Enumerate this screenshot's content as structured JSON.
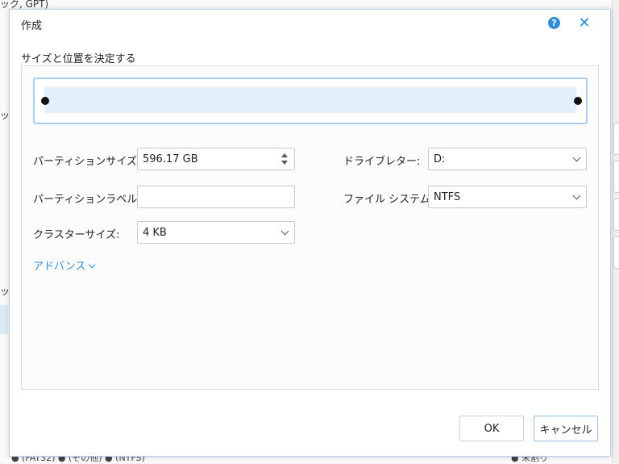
{
  "background": {
    "top_text": "ック, GPT)",
    "mid_text_1": "ッ",
    "mid_text_2": "ッ",
    "legend": "● (FAT32)    ● (その他)    ● (NTFS)",
    "legend_right": "● 未割り"
  },
  "dialog": {
    "title": "作成",
    "help_label": "?",
    "close_label": "✕",
    "section_label": "サイズと位置を決定する",
    "partition_size_label": "パーティションサイズ:",
    "partition_size_value": "596.17 GB",
    "partition_label_label": "パーティションラベル:",
    "partition_label_value": "",
    "cluster_size_label": "クラスターサイズ:",
    "cluster_size_value": "4 KB",
    "drive_letter_label": "ドライブレター:",
    "drive_letter_value": "D:",
    "file_system_label": "ファイル システム:",
    "file_system_value": "NTFS",
    "advanced_label": "アドバンス",
    "ok_label": "OK",
    "cancel_label": "キャンセル"
  },
  "colors": {
    "accent": "#2e8ed8",
    "bar_fill": "#e3f0fc",
    "bar_border": "#a9cdf0"
  },
  "icons": {
    "help": "question-circle-icon",
    "close": "close-icon",
    "dropdown": "chevron-down-icon",
    "spinner": "spinner-arrows-icon"
  }
}
